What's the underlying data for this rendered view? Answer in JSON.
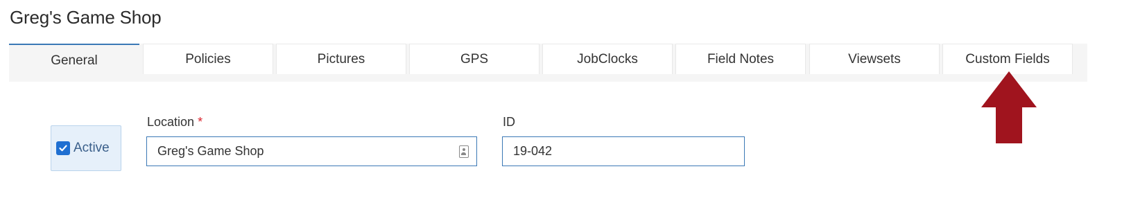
{
  "page": {
    "title": "Greg's Game Shop"
  },
  "tabs": [
    {
      "label": "General",
      "active": true
    },
    {
      "label": "Policies",
      "active": false
    },
    {
      "label": "Pictures",
      "active": false
    },
    {
      "label": "GPS",
      "active": false
    },
    {
      "label": "JobClocks",
      "active": false
    },
    {
      "label": "Field Notes",
      "active": false
    },
    {
      "label": "Viewsets",
      "active": false
    },
    {
      "label": "Custom Fields",
      "active": false
    }
  ],
  "form": {
    "active_label": "Active",
    "active_checked": true,
    "location_label": "Location",
    "required_marker": "*",
    "location_value": "Greg's Game Shop",
    "id_label": "ID",
    "id_value": "19-042"
  },
  "colors": {
    "accent": "#3a78b5",
    "checkbox": "#1f6fd1",
    "required": "#d9232d",
    "annotation_arrow": "#a0141e"
  },
  "icons": {
    "location_field_icon": "contact-card-icon",
    "annotation": "up-arrow-icon"
  }
}
